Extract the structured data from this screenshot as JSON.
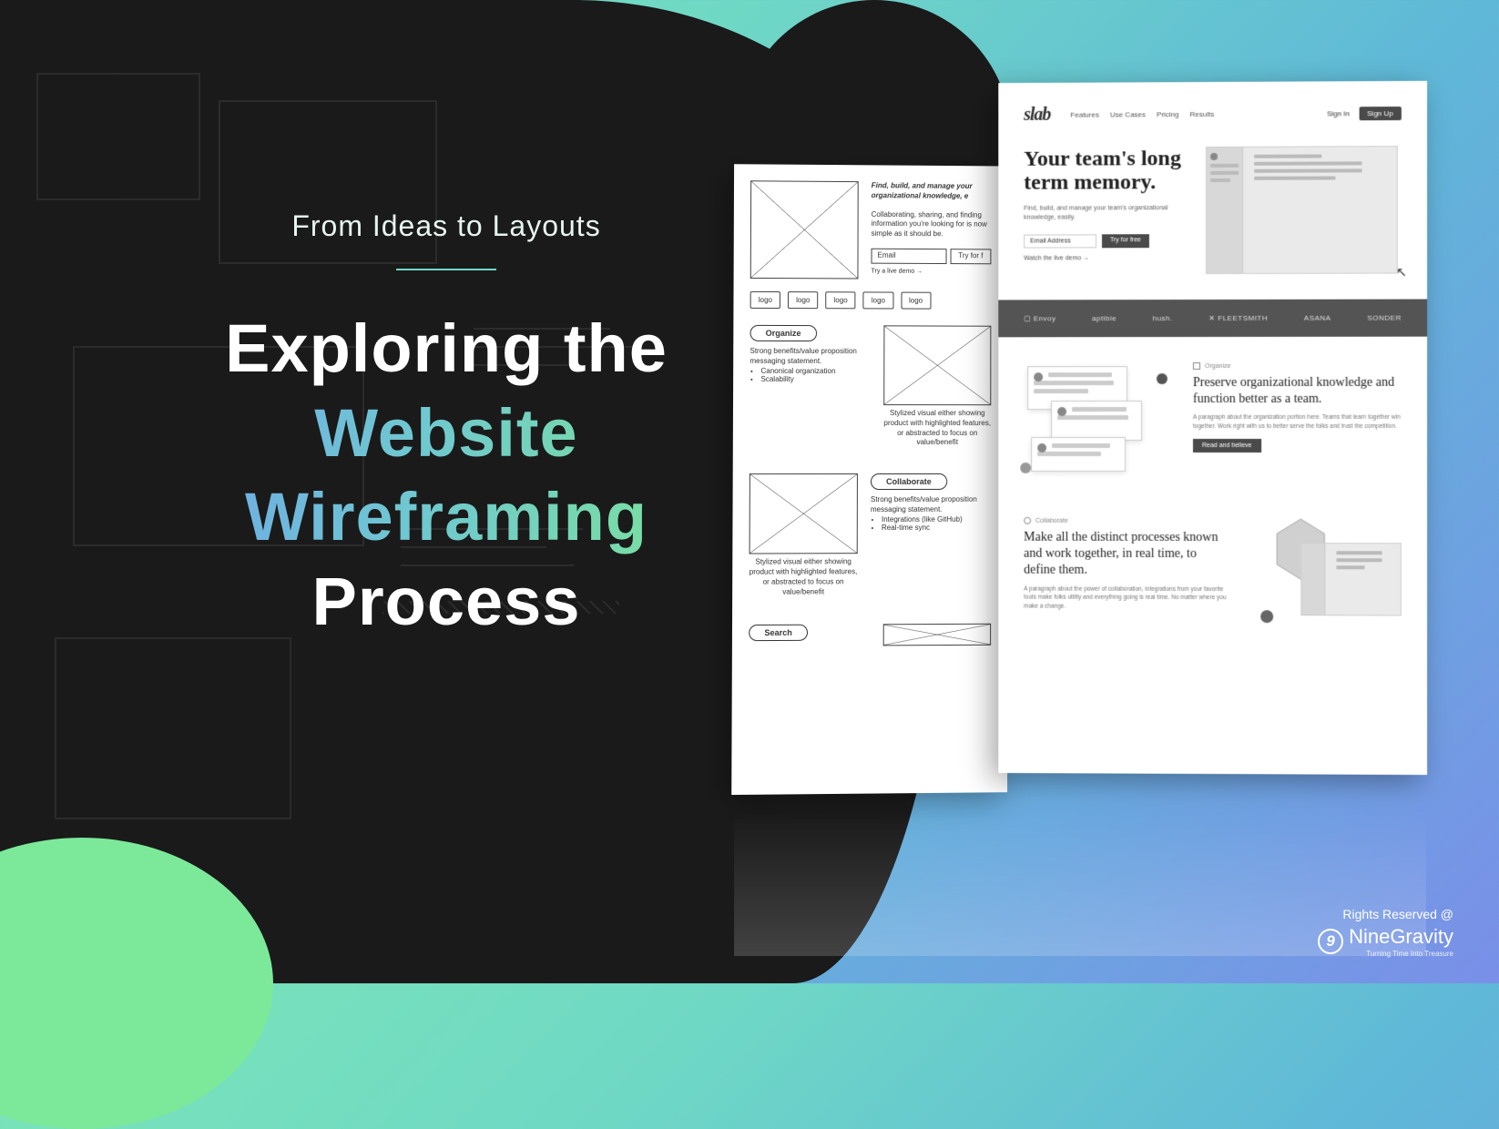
{
  "headline": {
    "pretitle": "From Ideas to Layouts",
    "line1": "Exploring the",
    "line2": "Website Wireframing",
    "line3": "Process"
  },
  "wireframe": {
    "hero_bold": "Find, build, and manage your organizational knowledge, e",
    "hero_body": "Collaborating, sharing, and finding information you're looking for is now simple as it should be.",
    "email_placeholder": "Email",
    "try_btn": "Try for f",
    "demo_link": "Try a live demo →",
    "logo_label": "logo",
    "pill_organize": "Organize",
    "organize_body": "Strong benefits/value proposition messaging statement.",
    "organize_bullets": [
      "Canonical organization",
      "Scalability"
    ],
    "styled_caption": "Stylized visual either showing product with highlighted features, or abstracted to focus on value/benefit",
    "pill_collaborate": "Collaborate",
    "collab_body": "Strong benefits/value proposition messaging statement.",
    "collab_bullets": [
      "Integrations (like GitHub)",
      "Real-time sync"
    ],
    "pill_search": "Search"
  },
  "hifi": {
    "logo": "slab",
    "nav": [
      "Features",
      "Use Cases",
      "Pricing",
      "Results"
    ],
    "signin": "Sign In",
    "signup": "Sign Up",
    "h1a": "Your team's long",
    "h1b": "term memory.",
    "sub": "Find, build, and manage your team's organizational knowledge, easily.",
    "email_ph": "Email Address",
    "try": "Try for free",
    "demo": "Watch the live demo →",
    "brands": [
      "Envoy",
      "aptible",
      "hush.",
      "FLEETSMITH",
      "ASANA",
      "SONDER"
    ],
    "tag_organize": "Organize",
    "feat1_h": "Preserve organizational knowledge and function better as a team.",
    "feat1_p": "A paragraph about the organization portion here. Teams that learn together win together. Work right with us to better serve the folks and trust the competition.",
    "feat1_btn": "Read and believe",
    "tag_collab": "Collaborate",
    "feat2_h": "Make all the distinct processes known and work together, in real time, to define them.",
    "feat2_p": "A paragraph about the power of collaboration, integrations from your favorite tools make folks utility and everything going is real time. No matter where you make a change."
  },
  "credit": {
    "rights": "Rights Reserved @",
    "brand": "NineGravity",
    "tagline": "Turning Time Into Treasure"
  }
}
